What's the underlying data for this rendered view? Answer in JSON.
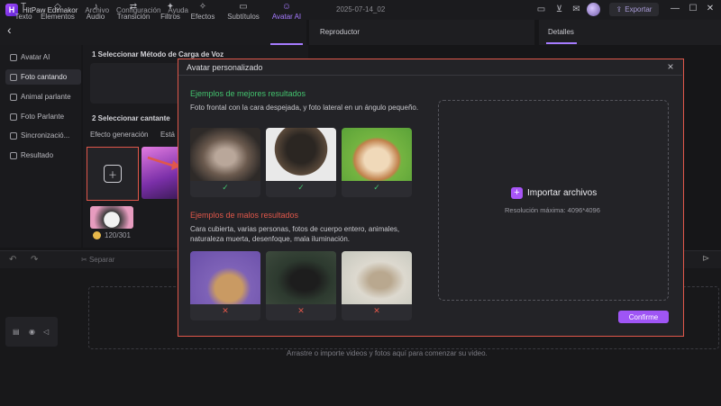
{
  "titlebar": {
    "app_name": "HitPaw Edimakor",
    "menu": [
      "Archivo",
      "Configuración",
      "Ayuda"
    ],
    "doc_name": "2025-07-14_02",
    "export_label": "Exportar"
  },
  "toolbar": {
    "tabs": [
      {
        "label": "Texto",
        "icon": "T"
      },
      {
        "label": "Elementos",
        "icon": "◇"
      },
      {
        "label": "Audio",
        "icon": "♪"
      },
      {
        "label": "Transición",
        "icon": "⇄"
      },
      {
        "label": "Filtros",
        "icon": "✦"
      },
      {
        "label": "Efectos",
        "icon": "✧"
      },
      {
        "label": "Subtítulos",
        "icon": "▭"
      },
      {
        "label": "Avatar AI",
        "icon": "☺"
      }
    ]
  },
  "player": {
    "title": "Reproductor"
  },
  "details": {
    "title": "Detalles"
  },
  "sidebar": {
    "items": [
      "Avatar AI",
      "Foto cantando",
      "Animal parlante",
      "Foto Parlante",
      "Sincronizació...",
      "Resultado"
    ]
  },
  "panel": {
    "step1": "1  Seleccionar Método de Carga de Voz",
    "step2": "2  Seleccionar cantante",
    "gen_effect": "Efecto generación",
    "gen_value": "Está",
    "credits": "120/301"
  },
  "timeline": {
    "split_label": "Separar",
    "drop_hint": "Arrastre o importe videos y fotos aquí para comenzar su video."
  },
  "modal": {
    "title": "Avatar personalizado",
    "good": {
      "heading": "Ejemplos de mejores resultados",
      "description": "Foto frontal con la cara despejada, y foto lateral en un ángulo pequeño.",
      "mark": "✓"
    },
    "bad": {
      "heading": "Ejemplos de malos resultados",
      "description": "Cara cubierta, varias personas, fotos de cuerpo entero, animales, naturaleza muerta, desenfoque, mala iluminación.",
      "mark": "✕"
    },
    "import_label": "Importar archivos",
    "resolution": "Resolución máxima: 4096*4096",
    "confirm_label": "Confirme",
    "close": "×"
  },
  "colors": {
    "accent": "#a855f7",
    "good": "#43c26e",
    "bad": "#e0574a",
    "highlight": "#e0574a"
  }
}
